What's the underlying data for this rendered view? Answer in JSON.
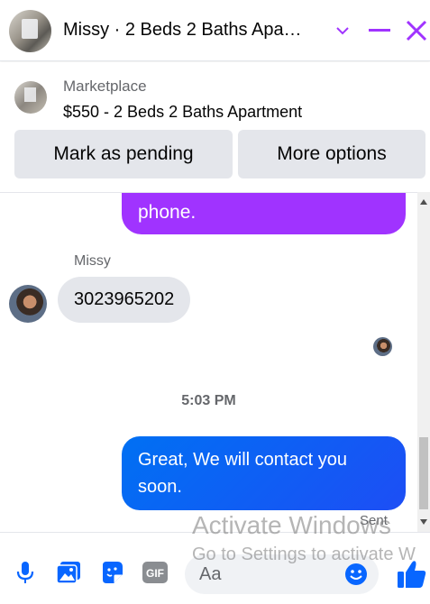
{
  "header": {
    "title": "Missy · 2 Beds 2 Baths Apa…",
    "accent": "#a033ff"
  },
  "marketplace": {
    "label": "Marketplace",
    "listing": "$550 - 2 Beds 2 Baths Apartment",
    "mark_pending": "Mark as pending",
    "more_options": "More options"
  },
  "conversation": {
    "prev_message_tail": "phone.",
    "sender_name": "Missy",
    "incoming_message": "3023965202",
    "timestamp": "5:03 PM",
    "outgoing_message": "Great, We will contact you soon.",
    "status": "Sent",
    "outgoing_color_purple": "#a033ff",
    "outgoing_color_blue": "#0866ff"
  },
  "composer": {
    "placeholder": "Aa",
    "icons": [
      "microphone-icon",
      "photo-icon",
      "sticker-icon",
      "gif-icon",
      "emoji-icon",
      "like-icon"
    ],
    "gif_label": "GIF"
  },
  "watermark": {
    "title": "Activate Windows",
    "subtitle": "Go to Settings to activate W"
  }
}
